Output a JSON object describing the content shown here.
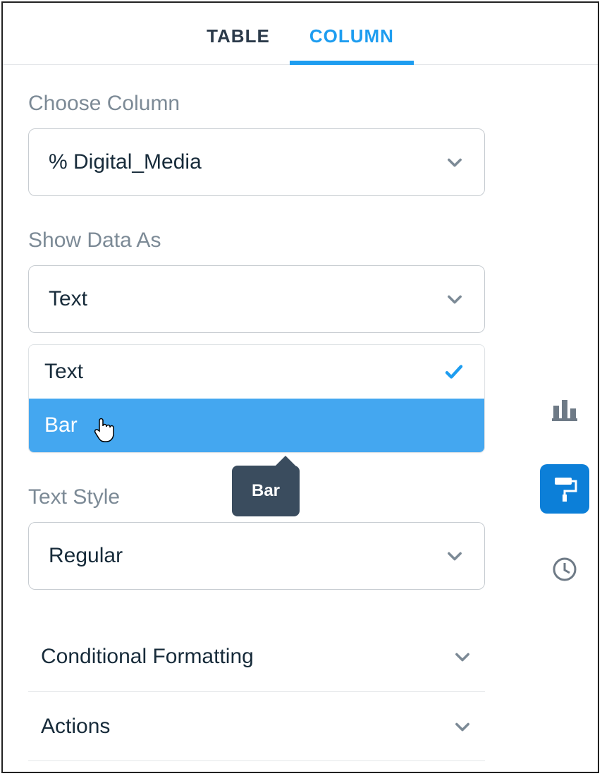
{
  "tabs": {
    "table": "TABLE",
    "column": "COLUMN"
  },
  "choose_column": {
    "label": "Choose Column",
    "value": "% Digital_Media"
  },
  "show_data_as": {
    "label": "Show Data As",
    "value": "Text",
    "options": {
      "text": "Text",
      "bar": "Bar"
    }
  },
  "tooltip": {
    "bar": "Bar"
  },
  "text_style": {
    "label": "Text Style",
    "value": "Regular"
  },
  "accordion": {
    "conditional_formatting": "Conditional Formatting",
    "actions": "Actions"
  }
}
